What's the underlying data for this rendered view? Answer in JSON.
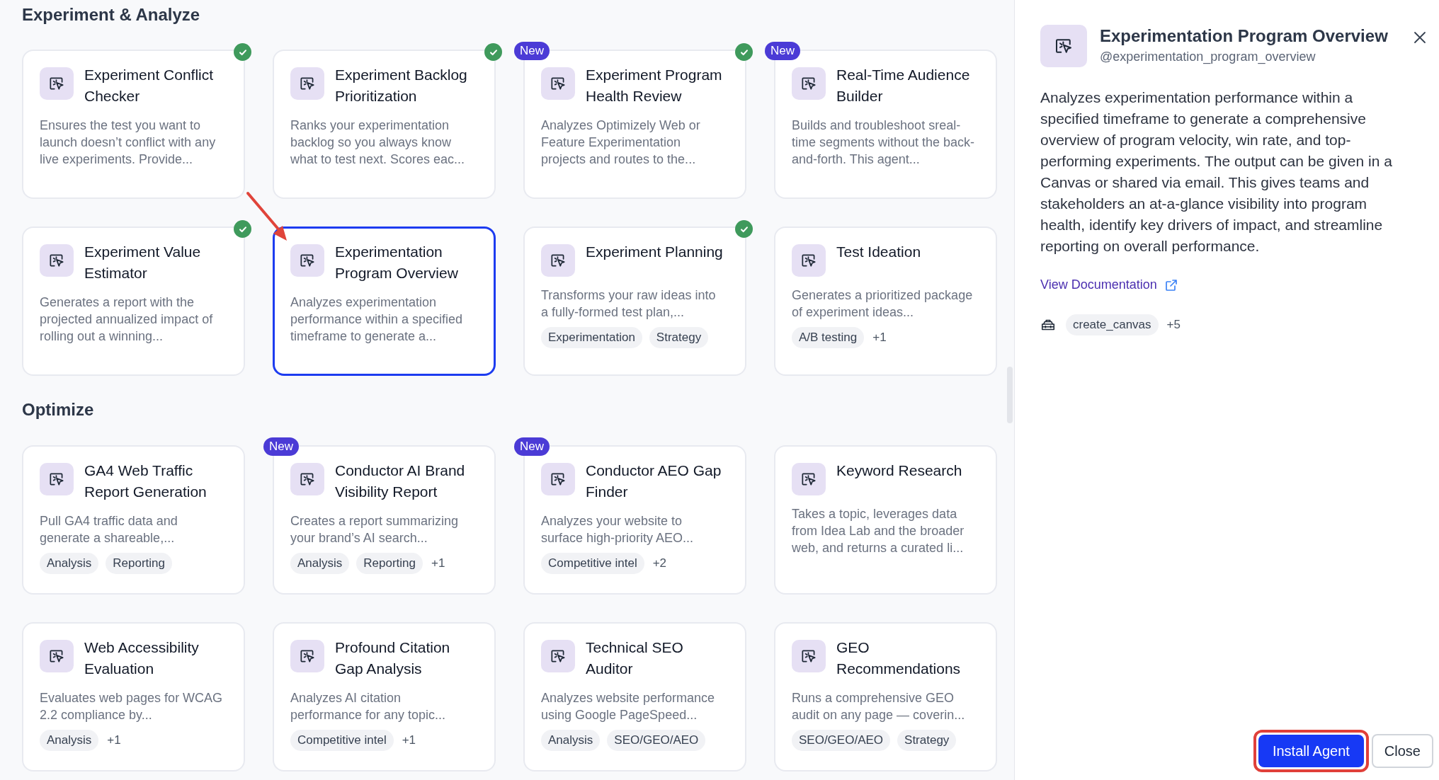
{
  "sections": [
    {
      "title": "Experiment & Analyze",
      "cards": [
        {
          "title": "Experiment Conflict Checker",
          "description": "Ensures the test you want to launch doesn’t conflict with any live experiments. Provide...",
          "installed": true,
          "selected": false
        },
        {
          "title": "Experiment Backlog Prioritization",
          "description": "Ranks your experimentation backlog so you always know what to test next. Scores eac...",
          "installed": true,
          "selected": false
        },
        {
          "title": "Experiment Program Health Review",
          "badge": "New",
          "description": "Analyzes Optimizely Web or Feature Experimentation projects and routes to the...",
          "installed": true,
          "selected": false
        },
        {
          "title": "Real-Time Audience Builder",
          "badge": "New",
          "description": "Builds and troubleshoot sreal-time segments without the back-and-forth. This agent...",
          "installed": false,
          "selected": false
        },
        {
          "title": "Experiment Value Estimator",
          "description": "Generates a report with the projected annualized impact of rolling out a winning...",
          "installed": true,
          "selected": false
        },
        {
          "title": "Experimentation Program Overview",
          "description": "Analyzes experimentation performance within a specified timeframe to generate a...",
          "installed": false,
          "selected": true,
          "pointer_arrow": true
        },
        {
          "title": "Experiment Planning",
          "description": "Transforms your raw ideas into a fully-formed test plan,...",
          "installed": true,
          "selected": false,
          "tags": [
            "Experimentation",
            "Strategy"
          ]
        },
        {
          "title": "Test Ideation",
          "description": "Generates a prioritized package of experiment ideas...",
          "installed": false,
          "selected": false,
          "tags": [
            "A/B testing"
          ],
          "more": "+1"
        }
      ]
    },
    {
      "title": "Optimize",
      "cards": [
        {
          "title": "GA4 Web Traffic Report Generation",
          "description": "Pull GA4 traffic data and generate a shareable,...",
          "installed": false,
          "selected": false,
          "tags": [
            "Analysis",
            "Reporting"
          ]
        },
        {
          "title": "Conductor AI Brand Visibility Report",
          "badge": "New",
          "description": "Creates a report summarizing your brand’s AI search...",
          "installed": false,
          "selected": false,
          "tags": [
            "Analysis",
            "Reporting"
          ],
          "more": "+1"
        },
        {
          "title": "Conductor AEO Gap Finder",
          "badge": "New",
          "description": "Analyzes your website to surface high-priority AEO...",
          "installed": false,
          "selected": false,
          "tags": [
            "Competitive intel"
          ],
          "more": "+2"
        },
        {
          "title": "Keyword Research",
          "description": "Takes a topic, leverages data from Idea Lab and the broader web, and returns a curated li...",
          "installed": false,
          "selected": false
        },
        {
          "title": "Web Accessibility Evaluation",
          "description": "Evaluates web pages for WCAG 2.2 compliance by...",
          "installed": false,
          "selected": false,
          "tags": [
            "Analysis"
          ],
          "more": "+1"
        },
        {
          "title": "Profound Citation Gap Analysis",
          "description": "Analyzes AI citation performance for any topic...",
          "installed": false,
          "selected": false,
          "tags": [
            "Competitive intel"
          ],
          "more": "+1"
        },
        {
          "title": "Technical SEO Auditor",
          "description": "Analyzes website performance using Google PageSpeed...",
          "installed": false,
          "selected": false,
          "tags": [
            "Analysis",
            "SEO/GEO/AEO"
          ]
        },
        {
          "title": "GEO Recommendations",
          "description": "Runs a comprehensive GEO audit on any page — coverin...",
          "installed": false,
          "selected": false,
          "tags": [
            "SEO/GEO/AEO",
            "Strategy"
          ]
        }
      ]
    }
  ],
  "detail": {
    "title": "Experimentation Program Overview",
    "handle": "@experimentation_program_overview",
    "description": "Analyzes experimentation performance within a specified timeframe to generate a comprehensive overview of program velocity, win rate, and top-performing experiments. The output can be given in a Canvas or shared via email. This gives teams and stakeholders an at-a-glance visibility into program health, identify key drivers of impact, and streamline reporting on overall performance.",
    "link": "View Documentation",
    "tools": [
      "create_canvas"
    ],
    "tools_more": "+5",
    "buttons": [
      {
        "label": "Install Agent",
        "kind": "primary",
        "highlighted": true
      },
      {
        "label": "Close",
        "kind": "secondary",
        "highlighted": false
      }
    ]
  }
}
